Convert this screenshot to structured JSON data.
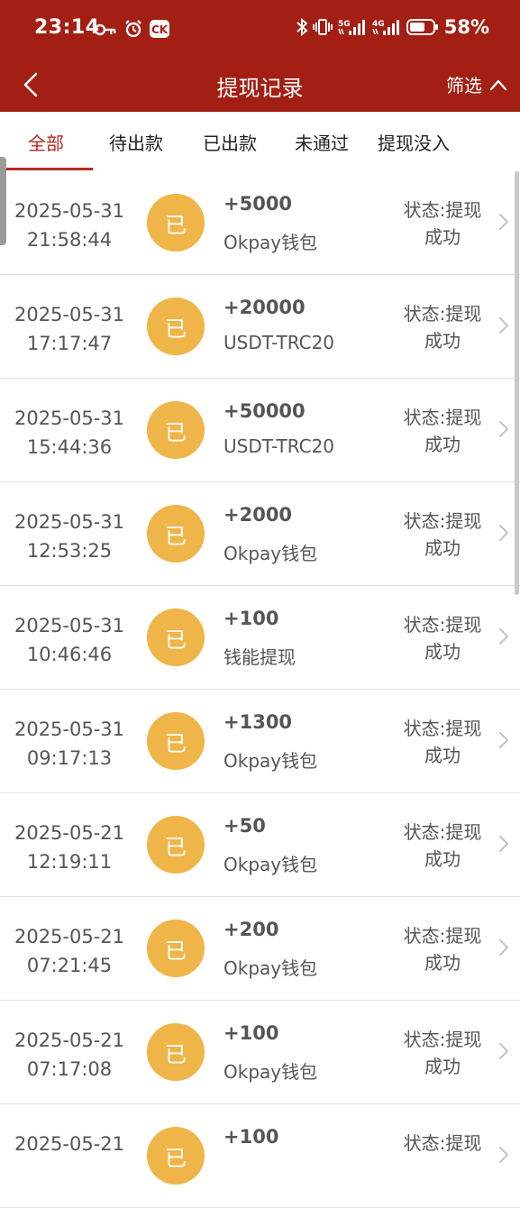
{
  "status_bar": {
    "time": "23:14",
    "battery": "58%",
    "signal1_label": "5G",
    "signal2_label": "4G",
    "left_icons": [
      "key-icon",
      "alarm-icon",
      "ck-app-icon"
    ],
    "right_icons": [
      "bluetooth-icon",
      "vibrate-icon",
      "signal-5g-icon",
      "signal-4g-icon",
      "battery-icon"
    ]
  },
  "navbar": {
    "title": "提现记录",
    "filter_label": "筛选",
    "back_icon": "chevron-left-icon",
    "filter_icon": "chevron-up-icon"
  },
  "tabs": [
    {
      "label": "全部",
      "active": true
    },
    {
      "label": "待出款",
      "active": false
    },
    {
      "label": "已出款",
      "active": false
    },
    {
      "label": "未通过",
      "active": false
    },
    {
      "label": "提现没入",
      "active": false
    }
  ],
  "records": [
    {
      "date": "2025-05-31",
      "time": "21:58:44",
      "badge": "已",
      "amount": "+5000",
      "method": "Okpay钱包",
      "status_line1": "状态:提现",
      "status_line2": "成功"
    },
    {
      "date": "2025-05-31",
      "time": "17:17:47",
      "badge": "已",
      "amount": "+20000",
      "method": "USDT-TRC20",
      "status_line1": "状态:提现",
      "status_line2": "成功"
    },
    {
      "date": "2025-05-31",
      "time": "15:44:36",
      "badge": "已",
      "amount": "+50000",
      "method": "USDT-TRC20",
      "status_line1": "状态:提现",
      "status_line2": "成功"
    },
    {
      "date": "2025-05-31",
      "time": "12:53:25",
      "badge": "已",
      "amount": "+2000",
      "method": "Okpay钱包",
      "status_line1": "状态:提现",
      "status_line2": "成功"
    },
    {
      "date": "2025-05-31",
      "time": "10:46:46",
      "badge": "已",
      "amount": "+100",
      "method": "钱能提现",
      "status_line1": "状态:提现",
      "status_line2": "成功"
    },
    {
      "date": "2025-05-31",
      "time": "09:17:13",
      "badge": "已",
      "amount": "+1300",
      "method": "Okpay钱包",
      "status_line1": "状态:提现",
      "status_line2": "成功"
    },
    {
      "date": "2025-05-21",
      "time": "12:19:11",
      "badge": "已",
      "amount": "+50",
      "method": "Okpay钱包",
      "status_line1": "状态:提现",
      "status_line2": "成功"
    },
    {
      "date": "2025-05-21",
      "time": "07:21:45",
      "badge": "已",
      "amount": "+200",
      "method": "Okpay钱包",
      "status_line1": "状态:提现",
      "status_line2": "成功"
    },
    {
      "date": "2025-05-21",
      "time": "07:17:08",
      "badge": "已",
      "amount": "+100",
      "method": "Okpay钱包",
      "status_line1": "状态:提现",
      "status_line2": "成功"
    },
    {
      "date": "2025-05-21",
      "time": "",
      "badge": "已",
      "amount": "+100",
      "method": "",
      "status_line1": "状态:提现",
      "status_line2": ""
    }
  ],
  "colors": {
    "brand_red": "#a31f14",
    "active_tab": "#b52a1e",
    "badge_orange": "#efb548",
    "text_gray": "#555555"
  }
}
